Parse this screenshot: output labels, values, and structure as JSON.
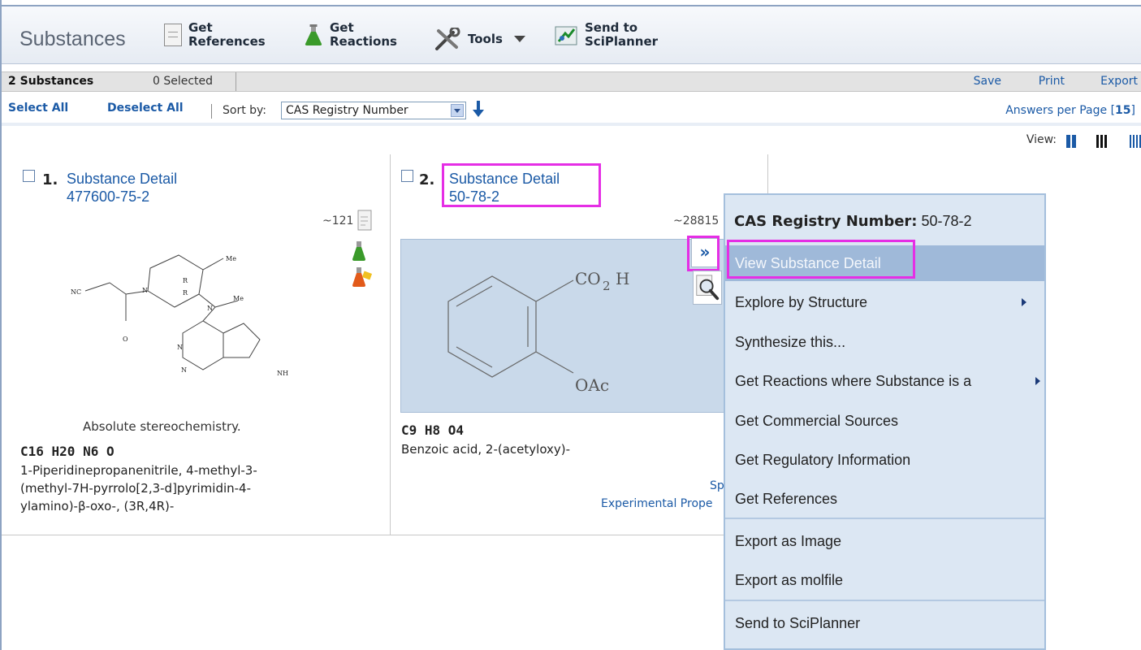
{
  "toolbar": {
    "title": "Substances",
    "get_references": [
      "Get",
      "References"
    ],
    "get_reactions": [
      "Get",
      "Reactions"
    ],
    "tools": "Tools",
    "send_to": [
      "Send to",
      "SciPlanner"
    ]
  },
  "infobar": {
    "count": "2 Substances",
    "selected": "0 Selected",
    "save": "Save",
    "print": "Print",
    "export": "Export"
  },
  "selectrow": {
    "select_all": "Select All",
    "deselect_all": "Deselect All",
    "sort_label": "Sort by:",
    "sort_value": "CAS Registry Number",
    "answers_label": "Answers per Page [",
    "answers_value": "15",
    "answers_end": "]"
  },
  "view": {
    "label": "View:"
  },
  "results": [
    {
      "index": "1.",
      "title": "Substance Detail",
      "cas": "477600-75-2",
      "ref_count": "~121",
      "stereo": "Absolute stereochemistry.",
      "formula": "C16 H20 N6 O",
      "name": [
        "1-Piperidinepropanenitrile, 4-methyl-3-",
        "(methyl-7H-pyrrolo[2,3-d]pyrimidin-4-",
        "ylamino)-β-oxo-, (3R,4R)-"
      ],
      "struct_labels": [
        "Me",
        "R",
        "R",
        "N",
        "Me",
        "NC",
        "O",
        "N",
        "N",
        "N",
        "NH"
      ]
    },
    {
      "index": "2.",
      "title": "Substance Detail",
      "cas": "50-78-2",
      "ref_count": "~28815",
      "formula": "C9 H8 O4",
      "name": "Benzoic acid, 2-(acetyloxy)-",
      "struct_labels": [
        "CO",
        "2",
        "H",
        "OAc"
      ],
      "link_spectra": "Sp",
      "link_experimental": "Experimental Prope",
      "expand_glyph": "»"
    }
  ],
  "context_menu": {
    "header_label": "CAS Registry Number:",
    "header_value": "50-78-2",
    "items": [
      "View Substance Detail",
      "Explore by Structure",
      "Synthesize this...",
      "Get Reactions where Substance is a",
      "Get Commercial Sources",
      "Get Regulatory Information",
      "Get References",
      "Export as Image",
      "Export as molfile",
      "Send to SciPlanner"
    ]
  },
  "colors": {
    "link": "#1b5aa6",
    "highlight": "#e52ee5",
    "menu_bg": "#dce7f3",
    "menu_active": "#9fb9d9"
  }
}
